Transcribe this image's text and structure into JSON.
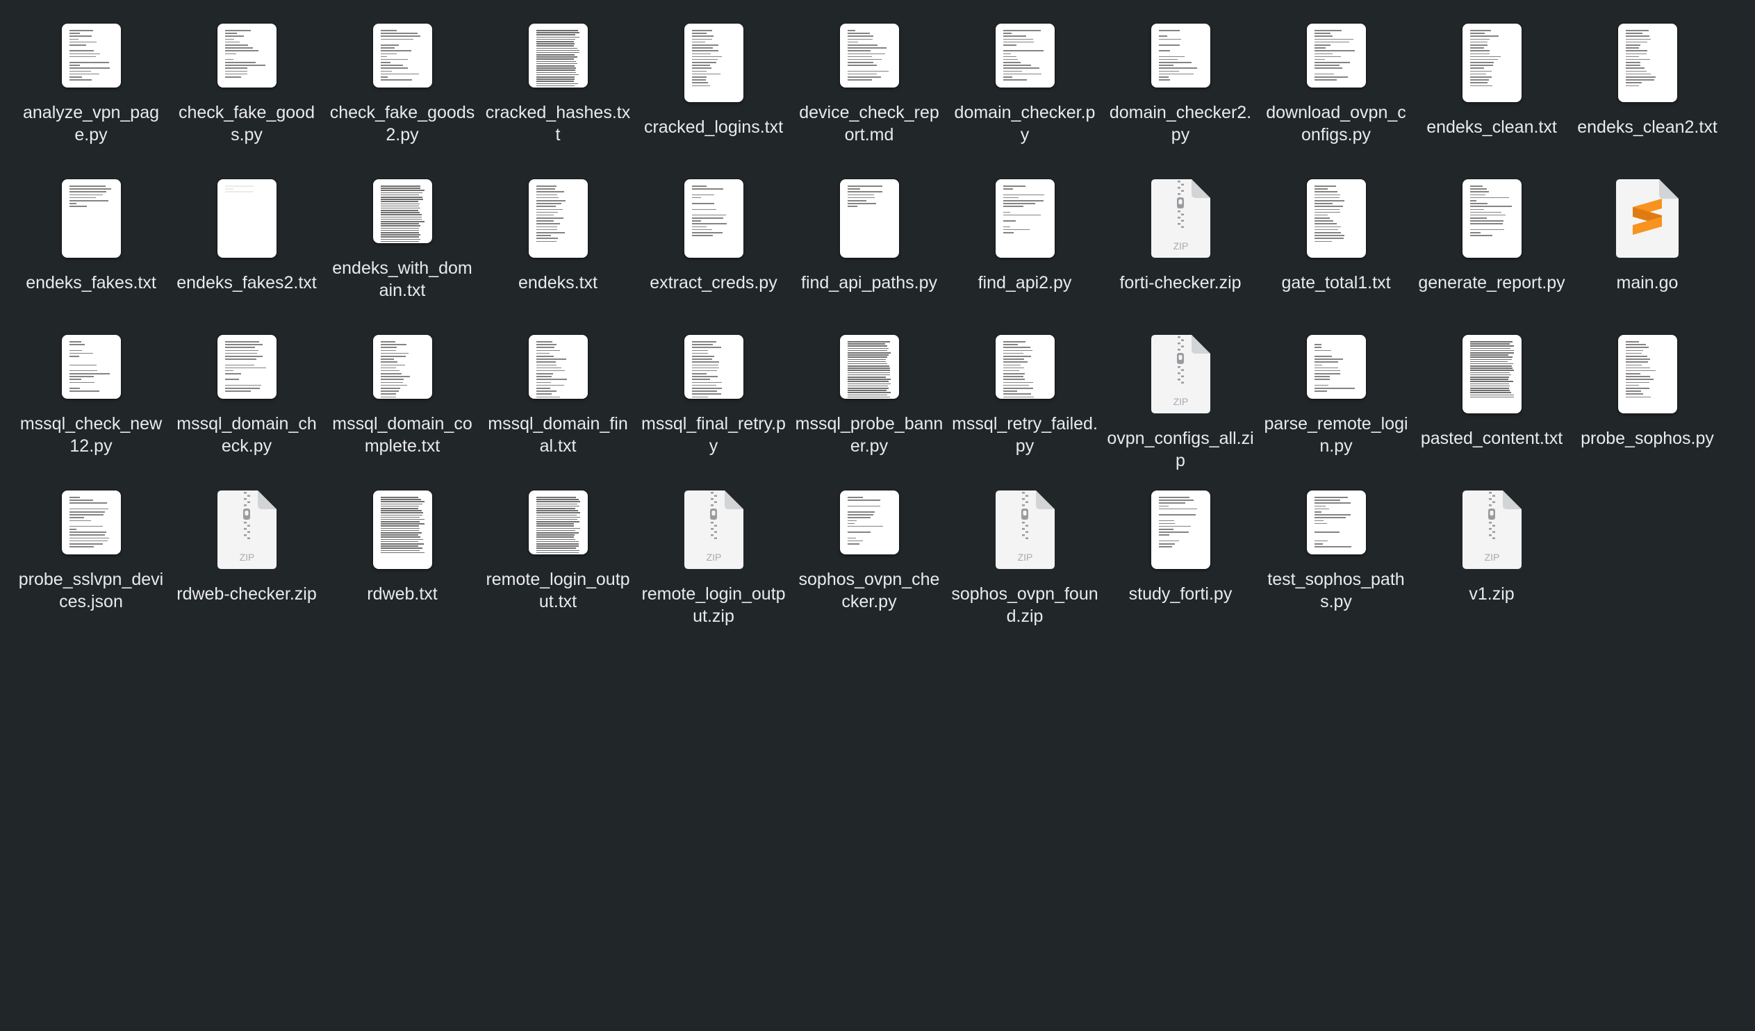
{
  "files": [
    {
      "name": "analyze_vpn_page.py",
      "type": "code",
      "icon": "document-thumbnail-icon"
    },
    {
      "name": "check_fake_goods.py",
      "type": "code",
      "icon": "document-thumbnail-icon"
    },
    {
      "name": "check_fake_goods2.py",
      "type": "code",
      "icon": "document-thumbnail-icon"
    },
    {
      "name": "cracked_hashes.txt",
      "type": "dense",
      "icon": "document-thumbnail-icon"
    },
    {
      "name": "cracked_logins.txt",
      "type": "list",
      "icon": "document-thumbnail-icon"
    },
    {
      "name": "device_check_report.md",
      "type": "code",
      "icon": "document-thumbnail-icon"
    },
    {
      "name": "domain_checker.py",
      "type": "code",
      "icon": "document-thumbnail-icon"
    },
    {
      "name": "domain_checker2.py",
      "type": "code",
      "icon": "document-thumbnail-icon"
    },
    {
      "name": "download_ovpn_configs.py",
      "type": "code",
      "icon": "document-thumbnail-icon"
    },
    {
      "name": "endeks_clean.txt",
      "type": "list",
      "icon": "document-thumbnail-icon"
    },
    {
      "name": "endeks_clean2.txt",
      "type": "list",
      "icon": "document-thumbnail-icon"
    },
    {
      "name": "endeks_fakes.txt",
      "type": "short",
      "icon": "document-thumbnail-icon"
    },
    {
      "name": "endeks_fakes2.txt",
      "type": "blank",
      "icon": "document-thumbnail-icon"
    },
    {
      "name": "endeks_with_domain.txt",
      "type": "dense",
      "icon": "document-thumbnail-icon"
    },
    {
      "name": "endeks.txt",
      "type": "list",
      "icon": "document-thumbnail-icon"
    },
    {
      "name": "extract_creds.py",
      "type": "code",
      "icon": "document-thumbnail-icon"
    },
    {
      "name": "find_api_paths.py",
      "type": "short",
      "icon": "document-thumbnail-icon"
    },
    {
      "name": "find_api2.py",
      "type": "code",
      "icon": "document-thumbnail-icon"
    },
    {
      "name": "forti-checker.zip",
      "type": "zip",
      "icon": "zip-archive-icon"
    },
    {
      "name": "gate_total1.txt",
      "type": "list",
      "icon": "document-thumbnail-icon"
    },
    {
      "name": "generate_report.py",
      "type": "code",
      "icon": "document-thumbnail-icon"
    },
    {
      "name": "main.go",
      "type": "go",
      "icon": "sublime-text-document-icon"
    },
    {
      "name": "mssql_check_new12.py",
      "type": "code",
      "icon": "document-thumbnail-icon"
    },
    {
      "name": "mssql_domain_check.py",
      "type": "code",
      "icon": "document-thumbnail-icon"
    },
    {
      "name": "mssql_domain_complete.txt",
      "type": "list",
      "icon": "document-thumbnail-icon"
    },
    {
      "name": "mssql_domain_final.txt",
      "type": "list",
      "icon": "document-thumbnail-icon"
    },
    {
      "name": "mssql_final_retry.py",
      "type": "list",
      "icon": "document-thumbnail-icon"
    },
    {
      "name": "mssql_probe_banner.py",
      "type": "dense",
      "icon": "document-thumbnail-icon"
    },
    {
      "name": "mssql_retry_failed.py",
      "type": "list",
      "icon": "document-thumbnail-icon"
    },
    {
      "name": "ovpn_configs_all.zip",
      "type": "zip",
      "icon": "zip-archive-icon"
    },
    {
      "name": "parse_remote_login.py",
      "type": "code",
      "icon": "document-thumbnail-icon"
    },
    {
      "name": "pasted_content.txt",
      "type": "dense",
      "icon": "document-thumbnail-icon"
    },
    {
      "name": "probe_sophos.py",
      "type": "list",
      "icon": "document-thumbnail-icon"
    },
    {
      "name": "probe_sslvpn_devices.json",
      "type": "code",
      "icon": "document-thumbnail-icon"
    },
    {
      "name": "rdweb-checker.zip",
      "type": "zip",
      "icon": "zip-archive-icon"
    },
    {
      "name": "rdweb.txt",
      "type": "dense",
      "icon": "document-thumbnail-icon"
    },
    {
      "name": "remote_login_output.txt",
      "type": "dense",
      "icon": "document-thumbnail-icon"
    },
    {
      "name": "remote_login_output.zip",
      "type": "zip",
      "icon": "zip-archive-icon"
    },
    {
      "name": "sophos_ovpn_checker.py",
      "type": "code",
      "icon": "document-thumbnail-icon"
    },
    {
      "name": "sophos_ovpn_found.zip",
      "type": "zip",
      "icon": "zip-archive-icon"
    },
    {
      "name": "study_forti.py",
      "type": "code",
      "icon": "document-thumbnail-icon"
    },
    {
      "name": "test_sophos_paths.py",
      "type": "code",
      "icon": "document-thumbnail-icon"
    },
    {
      "name": "v1.zip",
      "type": "zip",
      "icon": "zip-archive-icon"
    }
  ],
  "zip_badge": "ZIP",
  "colors": {
    "background": "#212629",
    "label": "#e9eaeb",
    "sublime_orange": "#f7931e"
  }
}
